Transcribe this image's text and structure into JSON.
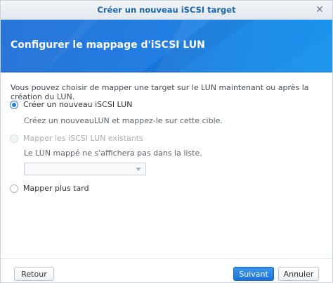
{
  "window": {
    "title": "Créer un nouveau iSCSI target"
  },
  "banner": {
    "heading": "Configurer le mappage d'iSCSI LUN"
  },
  "content": {
    "description": "Vous pouvez choisir de mapper une target sur le LUN maintenant ou après la création du LUN.",
    "options": [
      {
        "label": "Créer un nouveau iSCSI LUN",
        "hint": "Créez un nouveauLUN et mappez-le sur cette cible.",
        "checked": true,
        "disabled": false
      },
      {
        "label": "Mapper les iSCSI LUN existants",
        "hint": "Le LUN mappé ne s'affichera pas dans la liste.",
        "checked": false,
        "disabled": true,
        "select_value": ""
      },
      {
        "label": "Mapper plus tard",
        "checked": false,
        "disabled": false
      }
    ]
  },
  "footer": {
    "back_label": "Retour",
    "next_label": "Suivant",
    "cancel_label": "Annuler"
  },
  "colors": {
    "accent": "#1f7be0",
    "title_text": "#1a64b2"
  }
}
